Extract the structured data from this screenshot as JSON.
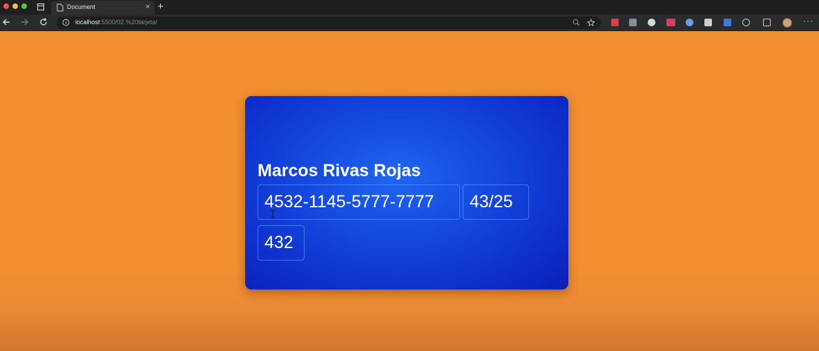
{
  "browser": {
    "tab": {
      "title": "Document",
      "close": "×"
    },
    "new_tab": "+",
    "address": {
      "host": "localhost",
      "path": ":5500/02.%20tarjeta/"
    },
    "more": "···"
  },
  "card": {
    "holder_name": "Marcos Rivas Rojas",
    "number": "4532-1145-5777-7777",
    "expiry": "43/25",
    "cvv": "432"
  },
  "colors": {
    "page_background": "#f28f30",
    "card_gradient_center": "#1f66f2",
    "card_gradient_edge": "#0a1fb5",
    "text": "#ffffff"
  }
}
